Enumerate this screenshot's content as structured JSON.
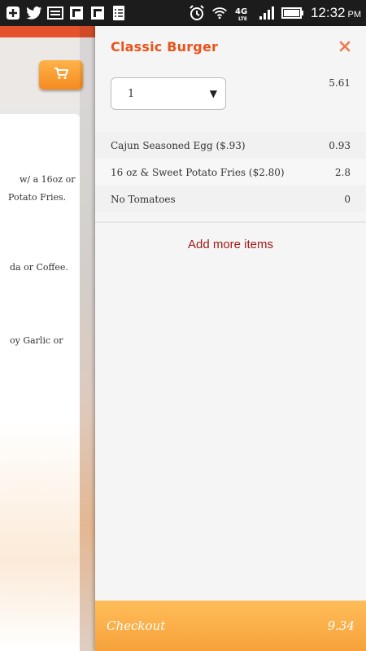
{
  "status_bar": {
    "time": "12:32",
    "ampm": "PM",
    "icons": [
      "app-plus-icon",
      "twitter-icon",
      "photo-icon",
      "flipboard-icon",
      "flipboard-icon",
      "checklist-icon",
      "alarm-icon",
      "wifi-icon",
      "4g-lte-icon",
      "signal-icon",
      "battery-icon"
    ]
  },
  "background_page": {
    "cart_icon": "cart-icon",
    "text_fragments": [
      "w/ a 16oz or",
      "Potato Fries.",
      "da or Coffee.",
      "oy Garlic or"
    ]
  },
  "panel": {
    "title": "Classic Burger",
    "close_icon": "close-icon",
    "quantity": "1",
    "item_price": "5.61",
    "options": [
      {
        "label": "Cajun Seasoned Egg ($.93)",
        "price": "0.93"
      },
      {
        "label": "16 oz & Sweet Potato Fries ($2.80)",
        "price": "2.8"
      },
      {
        "label": "No Tomatoes",
        "price": "0"
      }
    ],
    "add_more_label": "Add more items",
    "checkout_label": "Checkout",
    "checkout_total": "9.34"
  },
  "colors": {
    "accent_orange": "#e8541c",
    "checkout_orange": "#f7a23a",
    "link_red": "#a01818"
  }
}
